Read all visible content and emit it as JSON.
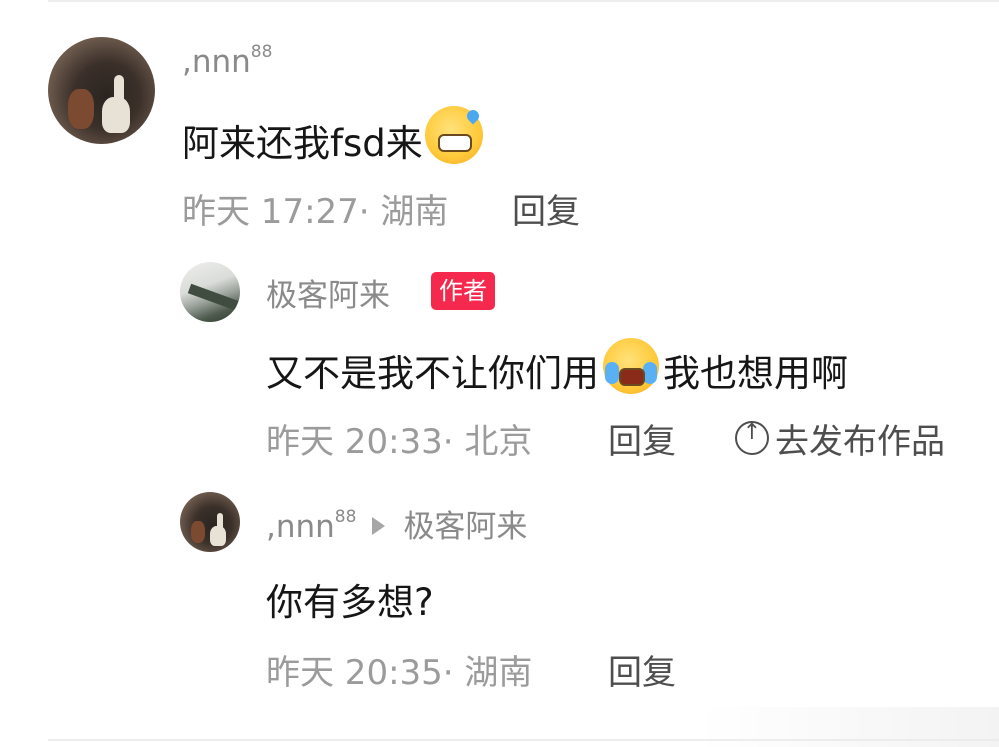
{
  "comments": {
    "c1": {
      "name": ",nnn",
      "name_sup": "88",
      "text": "阿来还我fsd来",
      "meta": "昨天 17:27· 湖南",
      "reply": "回复"
    },
    "c2": {
      "name": "极客阿来",
      "badge": "作者",
      "text_a": "又不是我不让你们用",
      "text_b": "我也想用啊",
      "meta": "昨天 20:33· 北京",
      "reply": "回复",
      "publish": "去发布作品"
    },
    "c3": {
      "name": ",nnn",
      "name_sup": "88",
      "reply_to": "极客阿来",
      "text": "你有多想?",
      "meta": "昨天 20:35· 湖南",
      "reply": "回复"
    }
  },
  "icons": {
    "emoji1": "grinning-sweat-emoji",
    "emoji2": "crying-laughing-emoji",
    "publish": "circle-up-arrow-icon",
    "reply_arrow": "triangle-right-icon"
  },
  "colors": {
    "badge": "#f5294d",
    "text": "#161616",
    "meta": "#9b9b9b"
  }
}
